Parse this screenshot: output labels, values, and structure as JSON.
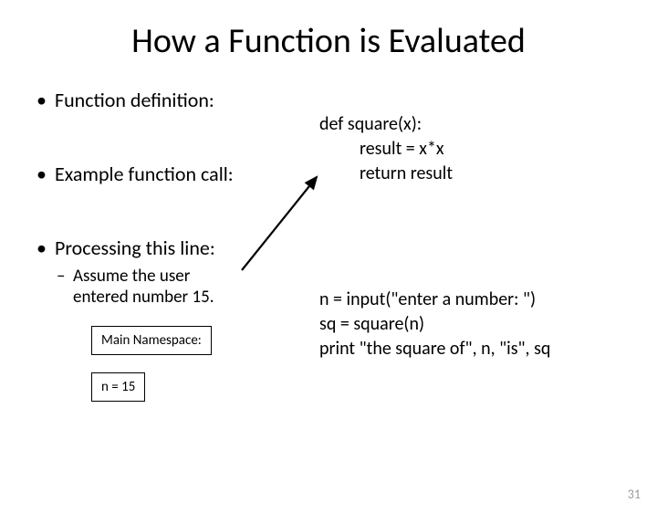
{
  "title": "How a Function is Evaluated",
  "bullets": {
    "b1": "Function definition:",
    "b2": "Example function call:",
    "b3": "Processing this line:"
  },
  "sub": {
    "s1a": "Assume the user",
    "s1b": "entered number 15."
  },
  "code": {
    "def_line1": "def square(x):",
    "def_line2": "result = x*x",
    "def_line3": "return result",
    "call_line1": "n = input(\"enter a number: \")",
    "call_line2": "sq = square(n)",
    "call_line3": "print \"the square of\", n, \"is\", sq"
  },
  "boxes": {
    "main_ns": "Main Namespace:",
    "n_val": "n = 15"
  },
  "page_number": "31"
}
